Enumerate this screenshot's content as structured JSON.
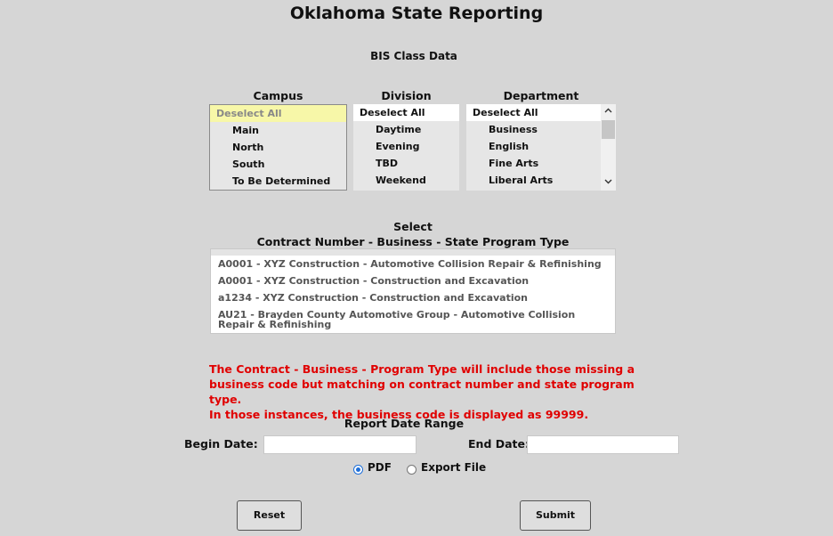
{
  "page": {
    "title": "Oklahoma State Reporting",
    "subtitle": "BIS Class Data"
  },
  "filters": {
    "campus": {
      "label": "Campus",
      "items": [
        "Deselect All",
        "Main",
        "North",
        "South",
        "To Be Determined"
      ]
    },
    "division": {
      "label": "Division",
      "items": [
        "Deselect All",
        "Daytime",
        "Evening",
        "TBD",
        "Weekend"
      ]
    },
    "department": {
      "label": "Department",
      "items": [
        "Deselect All",
        "Business",
        "English",
        "Fine Arts",
        "Liberal Arts"
      ]
    }
  },
  "contracts": {
    "heading_line1": "Select",
    "heading_line2": "Contract Number - Business - State Program Type",
    "items": [
      "A0001 - XYZ Construction - Automotive Collision Repair & Refinishing",
      "A0001 - XYZ Construction - Construction and Excavation",
      "a1234 - XYZ Construction - Construction and Excavation",
      "AU21 - Brayden County Automotive Group - Automotive Collision Repair & Refinishing"
    ]
  },
  "notice": {
    "line1": "The Contract - Business - Program Type will include those missing a",
    "line2": "business code but matching on contract number and state program type.",
    "line3": "In those instances, the business code is displayed as 99999.",
    "color": "#e00000"
  },
  "date_range": {
    "label": "Report Date Range",
    "begin_label": "Begin Date:",
    "begin_value": "",
    "end_label": "End Date:",
    "end_value": ""
  },
  "output": {
    "options": [
      "PDF",
      "Export File"
    ],
    "selected": "PDF"
  },
  "buttons": {
    "reset": "Reset",
    "submit": "Submit"
  },
  "icons": {
    "scroll_up": "chevron-up-icon",
    "scroll_down": "chevron-down-icon"
  }
}
